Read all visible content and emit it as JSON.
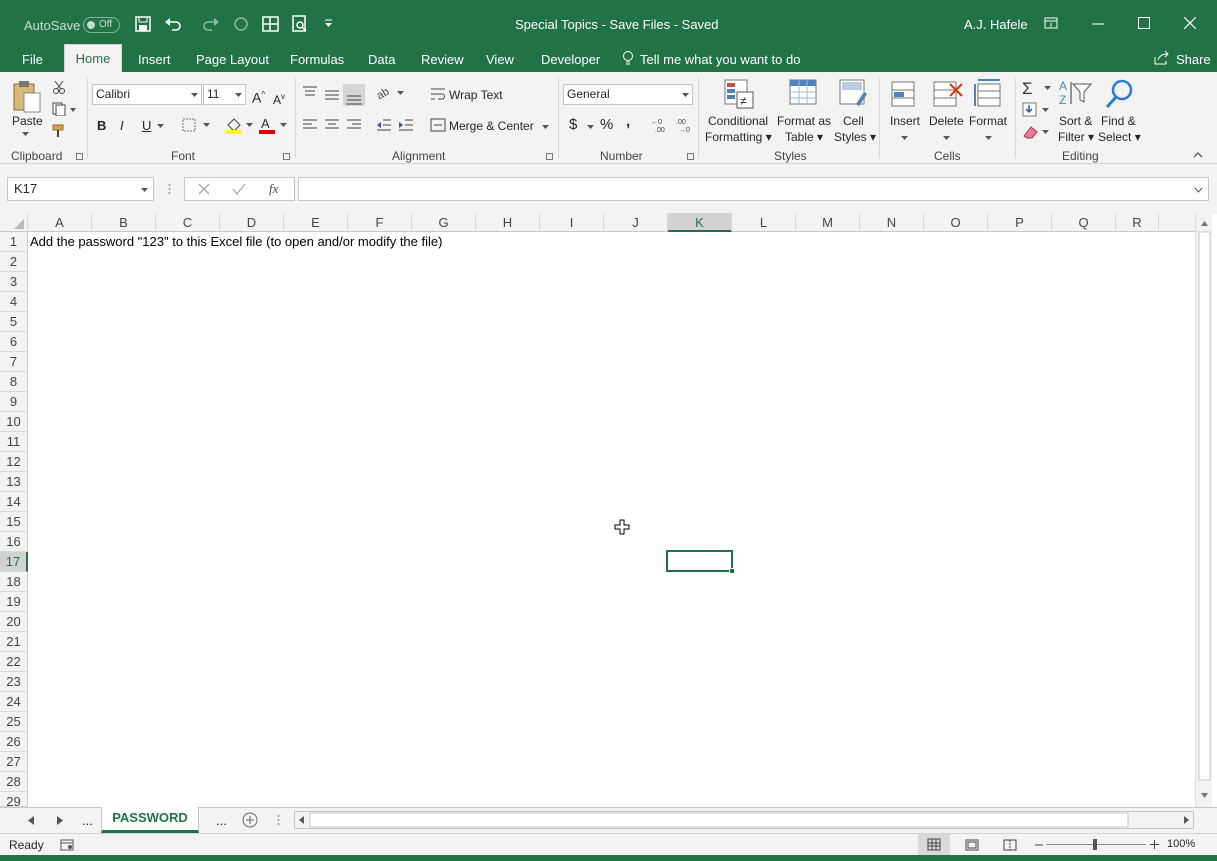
{
  "titlebar": {
    "autosave_label": "AutoSave",
    "autosave_state": "Off",
    "doc_title": "Special Topics - Save Files  -  Saved",
    "user": "A.J. Hafele"
  },
  "menu": {
    "tabs": [
      "File",
      "Home",
      "Insert",
      "Page Layout",
      "Formulas",
      "Data",
      "Review",
      "View",
      "Developer"
    ],
    "tell_me": "Tell me what you want to do",
    "share": "Share"
  },
  "ribbon": {
    "clipboard": {
      "paste": "Paste",
      "label": "Clipboard"
    },
    "font": {
      "name": "Calibri",
      "size": "11",
      "label": "Font",
      "bold": "B",
      "italic": "I",
      "underline": "U"
    },
    "alignment": {
      "wrap": "Wrap Text",
      "merge": "Merge & Center",
      "label": "Alignment"
    },
    "number": {
      "format": "General",
      "label": "Number",
      "currency": "$",
      "percent": "%",
      "comma": ","
    },
    "styles": {
      "cond1": "Conditional",
      "cond2": "Formatting",
      "fmt1": "Format as",
      "fmt2": "Table",
      "cell1": "Cell",
      "cell2": "Styles",
      "label": "Styles"
    },
    "cells": {
      "insert": "Insert",
      "delete": "Delete",
      "format": "Format",
      "label": "Cells"
    },
    "editing": {
      "sort1": "Sort &",
      "sort2": "Filter",
      "find1": "Find &",
      "find2": "Select",
      "label": "Editing"
    }
  },
  "formula_bar": {
    "name_box": "K17",
    "fx": "fx",
    "formula": ""
  },
  "sheet": {
    "columns": [
      "A",
      "B",
      "C",
      "D",
      "E",
      "F",
      "G",
      "H",
      "I",
      "J",
      "K",
      "L",
      "M",
      "N",
      "O",
      "P",
      "Q",
      "R"
    ],
    "rows": [
      "1",
      "2",
      "3",
      "4",
      "5",
      "6",
      "7",
      "8",
      "9",
      "10",
      "11",
      "12",
      "13",
      "14",
      "15",
      "16",
      "17",
      "18",
      "19",
      "20",
      "21",
      "22",
      "23",
      "24",
      "25",
      "26",
      "27",
      "28",
      "29"
    ],
    "a1": "Add the password \"123\" to this Excel file (to open and/or modify the file)",
    "selected_cell": "K17"
  },
  "sheet_tabs": {
    "ellipsis_left": "...",
    "active": "PASSWORD",
    "ellipsis_right": "..."
  },
  "status": {
    "state": "Ready",
    "zoom": "100%"
  },
  "colors": {
    "accent": "#217346",
    "ribbon_bg": "#f3f3f3"
  }
}
